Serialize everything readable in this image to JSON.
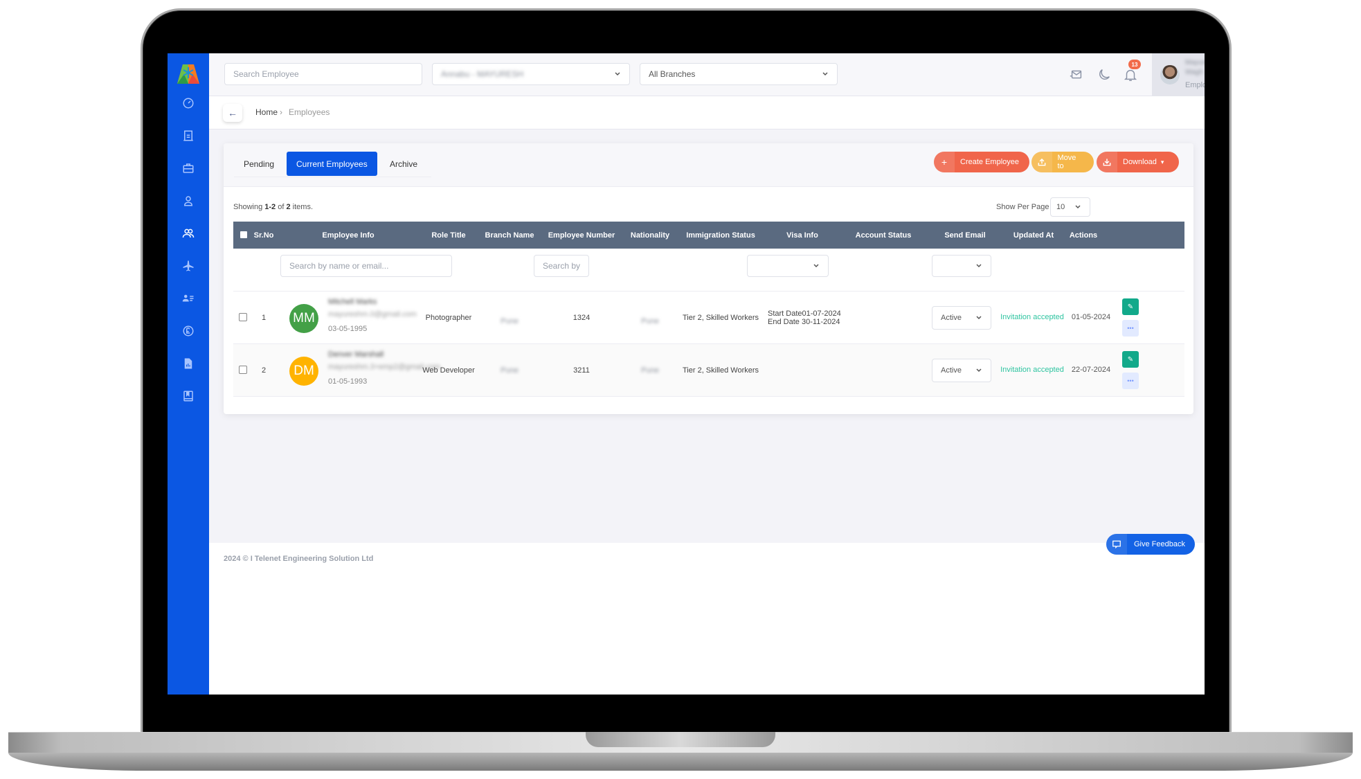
{
  "header": {
    "search_placeholder": "Search Employee",
    "company_select": "Annabu - MAYURESH",
    "branch_select": "All Branches",
    "notification_count": "13",
    "profile": {
      "name": "Mayuresh Wagh",
      "role": "Employer"
    }
  },
  "sidebar": {
    "items": [
      {
        "icon": "dashboard-icon"
      },
      {
        "icon": "building-icon"
      },
      {
        "icon": "briefcase-icon"
      },
      {
        "icon": "user-icon"
      },
      {
        "icon": "users-icon",
        "active": true
      },
      {
        "icon": "airplane-icon"
      },
      {
        "icon": "contact-list-icon"
      },
      {
        "icon": "pound-icon"
      },
      {
        "icon": "report-icon"
      },
      {
        "icon": "book-icon"
      }
    ]
  },
  "breadcrumb": {
    "home": "Home",
    "separator": "›",
    "current": "Employees"
  },
  "tabs": [
    {
      "label": "Pending",
      "active": false
    },
    {
      "label": "Current Employees",
      "active": true
    },
    {
      "label": "Archive",
      "active": false
    }
  ],
  "actions": {
    "create": "Create Employee",
    "move": "Move to",
    "download": "Download"
  },
  "summary": {
    "prefix": "Showing",
    "range": "1-2",
    "of": "of",
    "total": "2",
    "suffix": "items."
  },
  "per_page": {
    "label": "Show Per Page",
    "value": "10"
  },
  "table": {
    "columns": [
      "Sr.No",
      "Employee Info",
      "Role Title",
      "Branch Name",
      "Employee Number",
      "Nationality",
      "Immigration Status",
      "Visa Info",
      "Account Status",
      "Send Email",
      "Updated At",
      "Actions"
    ],
    "filters": {
      "employee_info_placeholder": "Search by name or email...",
      "branch_placeholder": "Search by"
    },
    "rows": [
      {
        "sr": "1",
        "initials": "MM",
        "avatar_color": "#43a047",
        "name": "Mitchell Marks",
        "email": "mayureshm.0@gmail.com",
        "dob": "03-05-1995",
        "role": "Photographer",
        "branch": "Pune",
        "employee_number": "1324",
        "nationality": "Pune",
        "immigration_status": "Tier 2, Skilled Workers",
        "visa_start_label": "Start Date",
        "visa_start": "01-07-2024",
        "visa_end_label": "End Date",
        "visa_end": "30-11-2024",
        "account_status": "Active",
        "send_email": "Invitation accepted",
        "updated_at": "01-05-2024"
      },
      {
        "sr": "2",
        "initials": "DM",
        "avatar_color": "#ffb300",
        "name": "Denver Marshall",
        "email": "mayureshm.3+emp2@gmail.com",
        "dob": "01-05-1993",
        "role": "Web Developer",
        "branch": "Pune",
        "employee_number": "3211",
        "nationality": "Pune",
        "immigration_status": "Tier 2, Skilled Workers",
        "visa_start_label": "",
        "visa_start": "",
        "visa_end_label": "",
        "visa_end": "",
        "account_status": "Active",
        "send_email": "Invitation accepted",
        "updated_at": "22-07-2024"
      }
    ]
  },
  "footer": {
    "copyright": "2024 © I Telenet Engineering Solution Ltd"
  },
  "feedback": {
    "label": "Give Feedback"
  },
  "colors": {
    "primary": "#0b57e3",
    "create": "#f0654a",
    "move": "#f5b74a",
    "download": "#f0654a",
    "table_header": "#5a6a80",
    "success": "#2ec4a0",
    "edit": "#12a98a"
  }
}
